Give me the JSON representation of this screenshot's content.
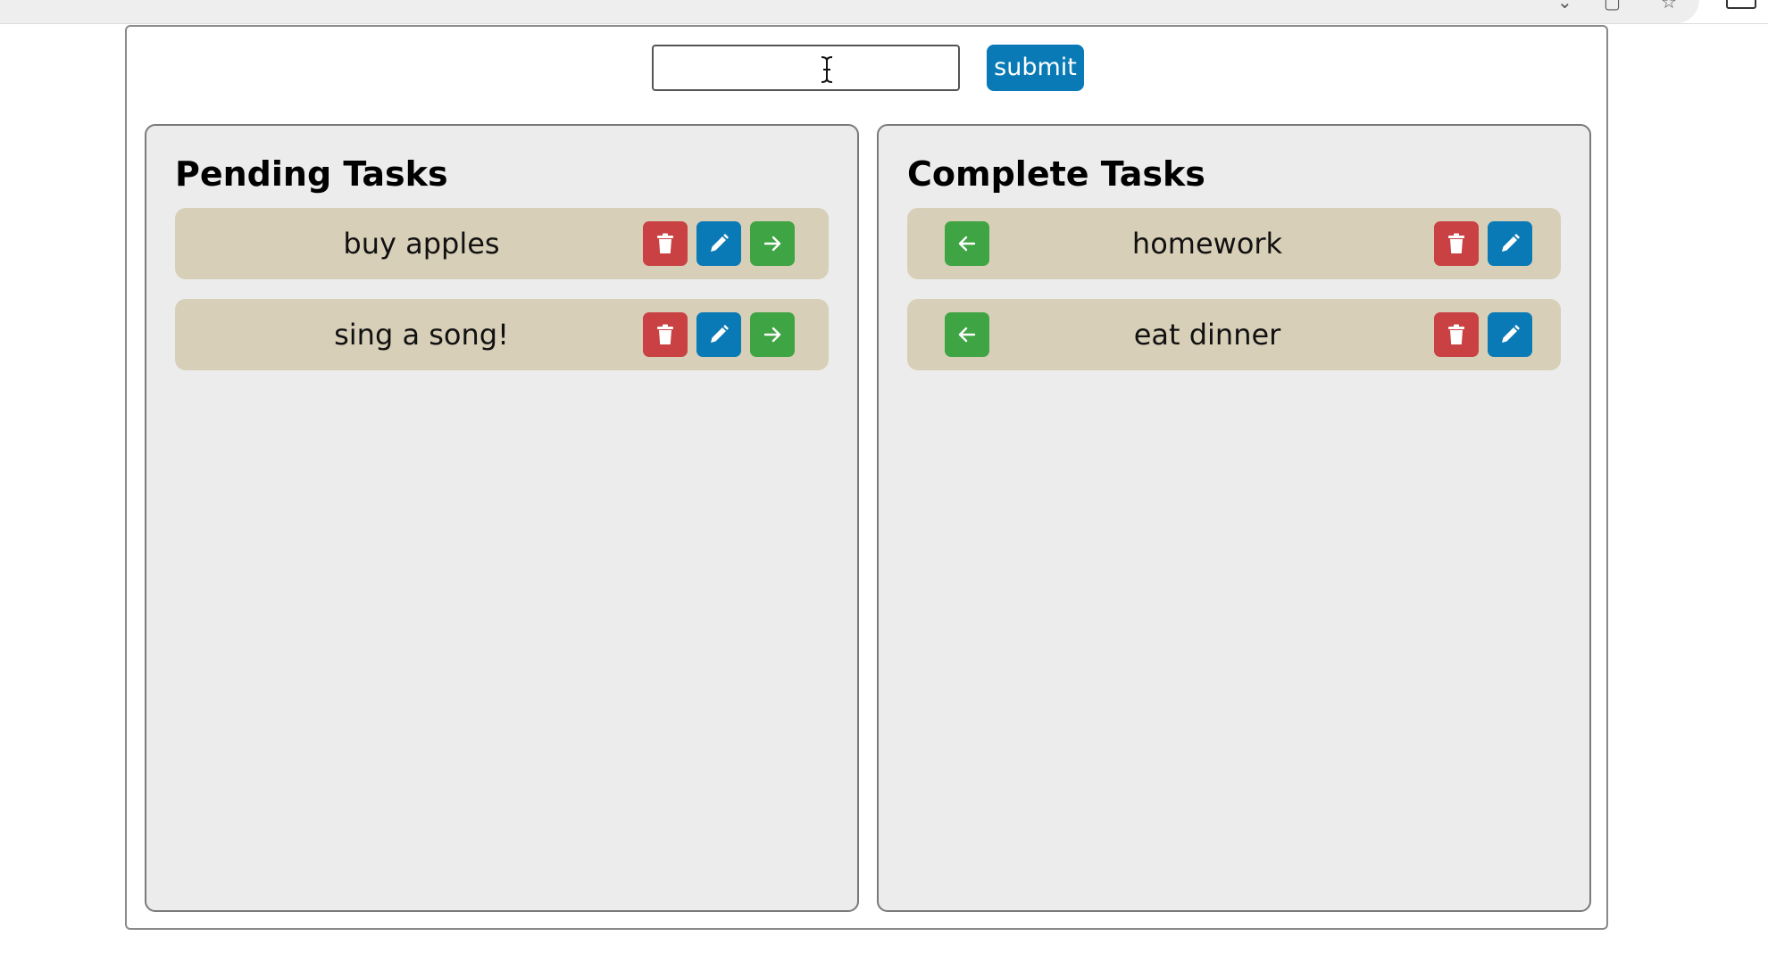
{
  "form": {
    "input_value": "",
    "submit_label": "submit"
  },
  "pending": {
    "title": "Pending Tasks",
    "tasks": [
      {
        "label": "buy apples"
      },
      {
        "label": "sing a song!"
      }
    ]
  },
  "complete": {
    "title": "Complete Tasks",
    "tasks": [
      {
        "label": "homework"
      },
      {
        "label": "eat dinner"
      }
    ]
  },
  "icons": {
    "delete": "trash-icon",
    "edit": "pencil-icon",
    "move_to_complete": "arrow-right-icon",
    "move_to_pending": "arrow-left-icon"
  },
  "colors": {
    "primary": "#0a7ab6",
    "danger": "#c94143",
    "success": "#3fa443",
    "task_background": "#d8cfb8",
    "panel_background": "#ececec"
  }
}
